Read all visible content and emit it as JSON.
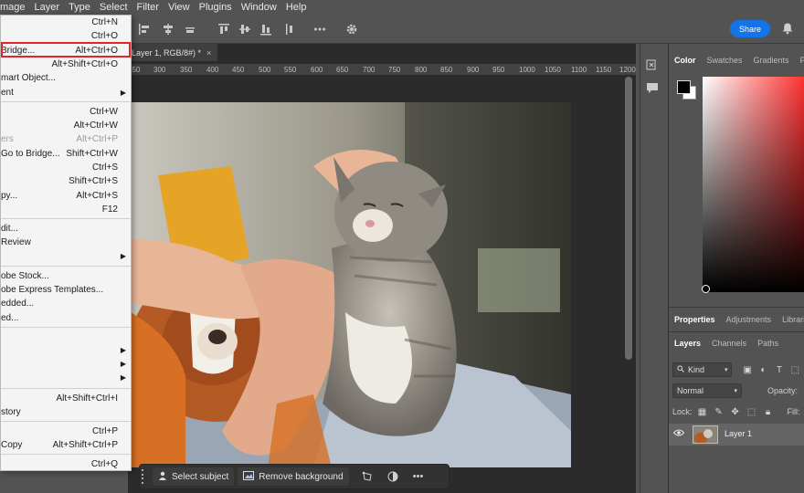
{
  "menubar": {
    "items": [
      "mage",
      "Layer",
      "Type",
      "Select",
      "Filter",
      "View",
      "Plugins",
      "Window",
      "Help"
    ]
  },
  "header": {
    "share_label": "Share"
  },
  "document": {
    "tab_title": "Layer 1, RGB/8#) *",
    "tab_close": "×",
    "ruler_ticks": [
      "250",
      "300",
      "350",
      "400",
      "450",
      "500",
      "550",
      "600",
      "650",
      "700",
      "750",
      "800",
      "850",
      "900",
      "950",
      "1000",
      "1050",
      "1100",
      "1150",
      "1200"
    ]
  },
  "file_menu": {
    "items": [
      {
        "label": "",
        "shortcut": "Ctrl+N"
      },
      {
        "label": "",
        "shortcut": "Ctrl+O"
      },
      {
        "label": "Bridge...",
        "shortcut": "Alt+Ctrl+O"
      },
      {
        "label": "",
        "shortcut": "Alt+Shift+Ctrl+O"
      },
      {
        "label": "mart Object...",
        "shortcut": ""
      },
      {
        "label": "ent",
        "shortcut": "",
        "submenu": true
      },
      {
        "label": "",
        "shortcut": "Ctrl+W"
      },
      {
        "label": "",
        "shortcut": "Alt+Ctrl+W"
      },
      {
        "label": "ers",
        "shortcut": "Alt+Ctrl+P",
        "disabled": true
      },
      {
        "label": "Go to Bridge...",
        "shortcut": "Shift+Ctrl+W"
      },
      {
        "label": "",
        "shortcut": "Ctrl+S"
      },
      {
        "label": "",
        "shortcut": "Shift+Ctrl+S"
      },
      {
        "label": "py...",
        "shortcut": "Alt+Ctrl+S"
      },
      {
        "label": "",
        "shortcut": "F12"
      },
      {
        "label": "dit...",
        "shortcut": ""
      },
      {
        "label": "Review",
        "shortcut": ""
      },
      {
        "label": "",
        "shortcut": "",
        "submenu": true
      },
      {
        "label": "obe Stock...",
        "shortcut": ""
      },
      {
        "label": "obe Express Templates...",
        "shortcut": ""
      },
      {
        "label": "edded...",
        "shortcut": ""
      },
      {
        "label": "ed...",
        "shortcut": ""
      },
      {
        "label": "",
        "shortcut": "",
        "submenu": true
      },
      {
        "label": "",
        "shortcut": "",
        "submenu": true
      },
      {
        "label": "",
        "shortcut": "",
        "submenu": true
      },
      {
        "label": "",
        "shortcut": "Alt+Shift+Ctrl+I"
      },
      {
        "label": "story",
        "shortcut": ""
      },
      {
        "label": "",
        "shortcut": "Ctrl+P"
      },
      {
        "label": "Copy",
        "shortcut": "Alt+Shift+Ctrl+P"
      },
      {
        "label": "",
        "shortcut": "Ctrl+Q"
      }
    ]
  },
  "taskbar": {
    "select_subject": "Select subject",
    "remove_background": "Remove background",
    "more": "•••"
  },
  "color_panel": {
    "tabs": [
      "Color",
      "Swatches",
      "Gradients",
      "P"
    ],
    "foreground": "#000000",
    "background": "#ffffff",
    "hue": "#ff3030"
  },
  "layers_panel": {
    "top_tabs": [
      "Properties",
      "Adjustments",
      "Librari"
    ],
    "tabs": [
      "Layers",
      "Channels",
      "Paths"
    ],
    "filter_kind": "Kind",
    "blend_mode": "Normal",
    "opacity_label": "Opacity:",
    "lock_label": "Lock:",
    "fill_label": "Fill:",
    "layers": [
      {
        "name": "Layer 1",
        "visible": true
      }
    ]
  }
}
